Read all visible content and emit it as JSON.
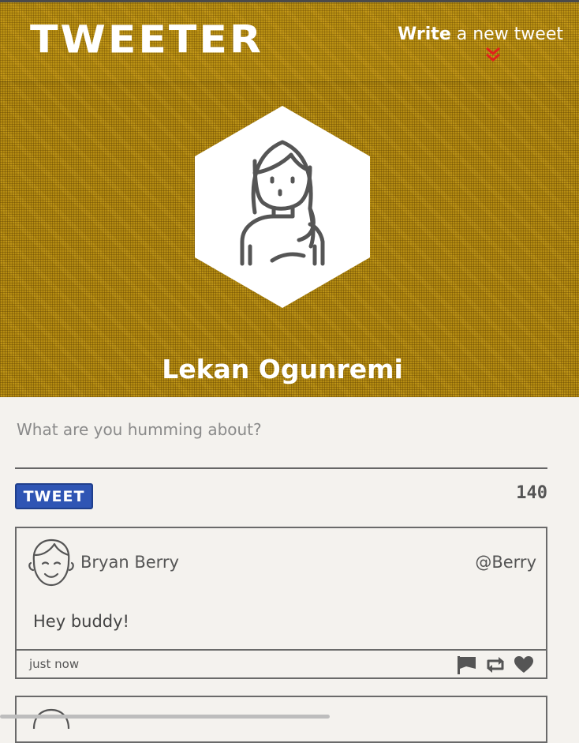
{
  "header": {
    "logo_text": "TWEETER",
    "compose_link": {
      "bold": "Write",
      "rest": " a new tweet"
    }
  },
  "profile": {
    "name": "Lekan Ogunremi"
  },
  "composer": {
    "placeholder": "What are you humming about?",
    "button_label": "TWEET",
    "char_count": "140"
  },
  "tweets": [
    {
      "author": "Bryan Berry",
      "handle": "@Berry",
      "text": "Hey buddy!",
      "time": "just now"
    }
  ],
  "colors": {
    "header_bg": "#b58c12",
    "button_bg": "#2f55b4",
    "chevron": "#e0221b",
    "page_bg": "#f4f2ee"
  }
}
